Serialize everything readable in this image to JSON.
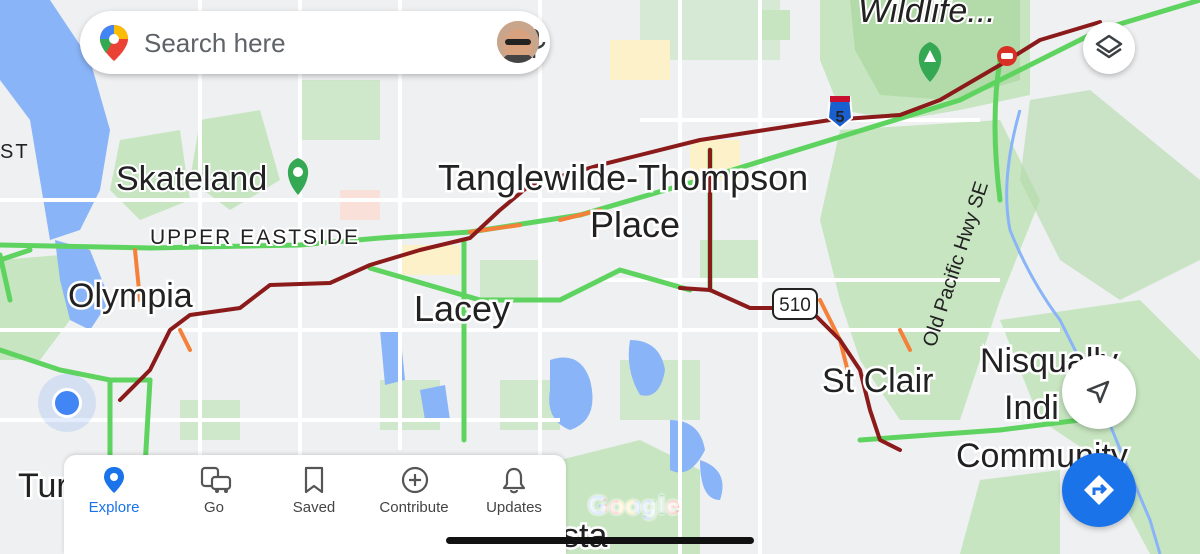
{
  "search": {
    "placeholder": "Search here"
  },
  "places": {
    "skateland": "Skateland",
    "upper_eastside": "UPPER EASTSIDE",
    "tanglewilde_line1": "Tanglewilde-Thompson",
    "tanglewilde_line2": "Place",
    "olympia": "Olympia",
    "lacey": "Lacey",
    "st_clair": "St Clair",
    "nisqually_line1": "Nisqually",
    "nisqually_line2": "Indi",
    "nisqually_line3": "Community",
    "wildlife": "Wildlife...",
    "tur": "Tur",
    "sta": "sta",
    "st_left": "ST"
  },
  "roads": {
    "i5_shield": "5",
    "sr510_shield": "510",
    "old_pacific": "Old Pacific Hwy SE"
  },
  "bottom_nav": {
    "explore": "Explore",
    "go": "Go",
    "saved": "Saved",
    "contribute": "Contribute",
    "updates": "Updates"
  },
  "attribution": {
    "google": "Google"
  },
  "colors": {
    "traffic_heavy": "#8b1a1a",
    "traffic_moderate": "#f4803a",
    "traffic_clear": "#5fd35f",
    "water": "#8ab4f8",
    "park": "#b7dfb1",
    "accent": "#1a73e8"
  }
}
